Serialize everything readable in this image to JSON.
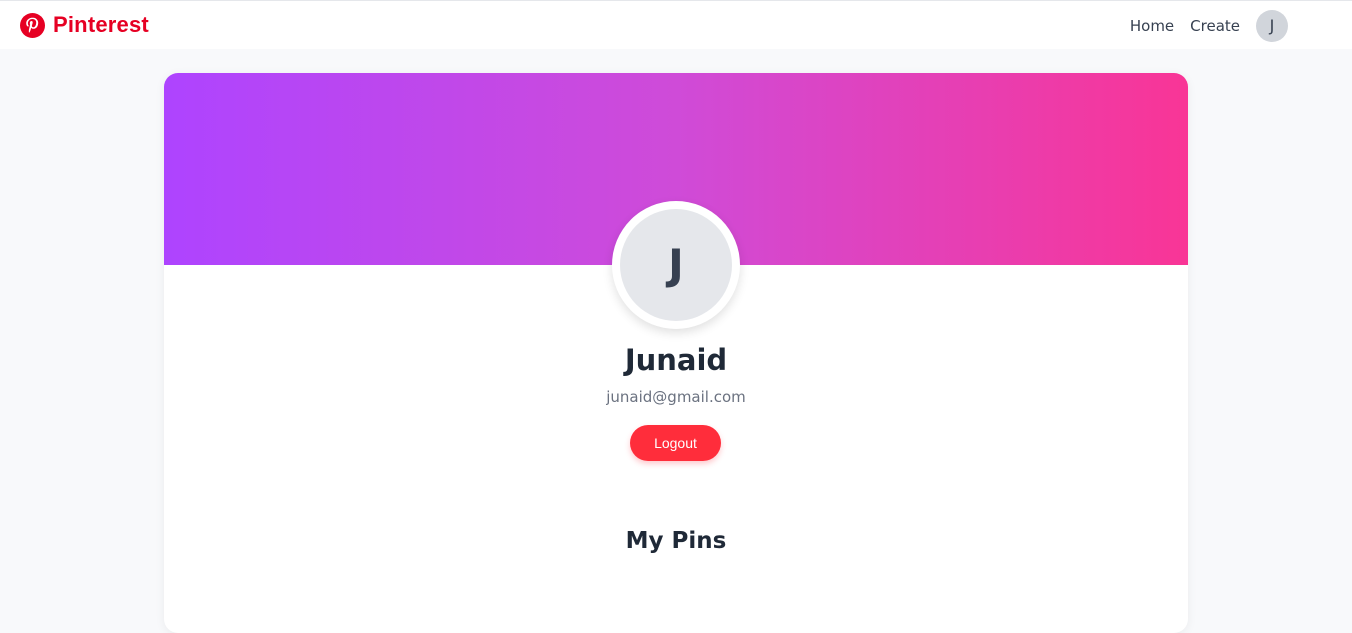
{
  "header": {
    "brand": "Pinterest",
    "brand_color": "#e60023",
    "nav": {
      "home": "Home",
      "create": "Create",
      "avatar_initial": "J"
    }
  },
  "profile": {
    "cover_gradient": [
      "#ae44ff",
      "#f93596"
    ],
    "avatar_initial": "J",
    "name": "Junaid",
    "email": "junaid@gmail.com",
    "logout_label": "Logout",
    "logout_color": "#ff2d3b"
  },
  "pins": {
    "title": "My Pins"
  }
}
